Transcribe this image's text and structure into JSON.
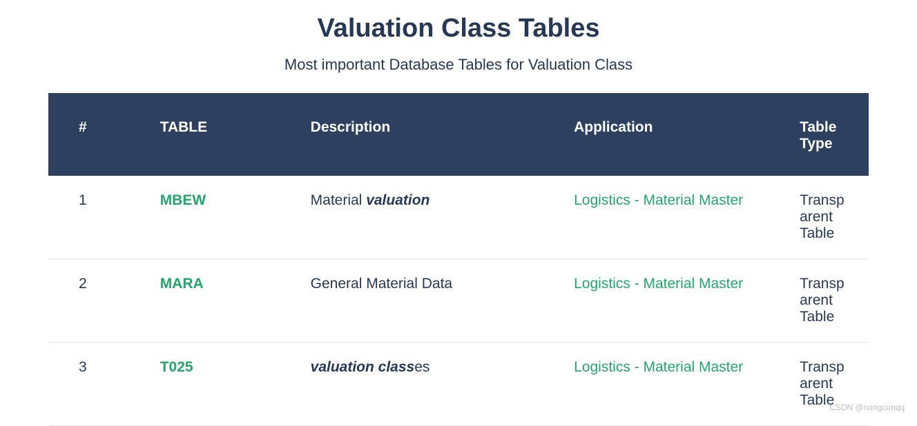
{
  "header": {
    "title": "Valuation Class Tables",
    "subtitle": "Most important Database Tables for Valuation Class"
  },
  "table": {
    "columns": {
      "col1": "#",
      "col2": "TABLE",
      "col3": "Description",
      "col4": "Application",
      "col5": "Table Type"
    },
    "rows": [
      {
        "num": "1",
        "table": "MBEW",
        "desc_prefix": "Material ",
        "desc_em": "valuation",
        "desc_suffix": "",
        "application": "Logistics - Material Master",
        "type": "Transparent Table"
      },
      {
        "num": "2",
        "table": "MARA",
        "desc_prefix": "General Material Data",
        "desc_em": "",
        "desc_suffix": "",
        "application": "Logistics - Material Master",
        "type": "Transparent Table"
      },
      {
        "num": "3",
        "table": "T025",
        "desc_prefix": "",
        "desc_em": "valuation class",
        "desc_suffix": "es",
        "application": "Logistics - Material Master",
        "type": "Transparent Table"
      }
    ]
  },
  "watermark": "CSDN @nongcunqq"
}
